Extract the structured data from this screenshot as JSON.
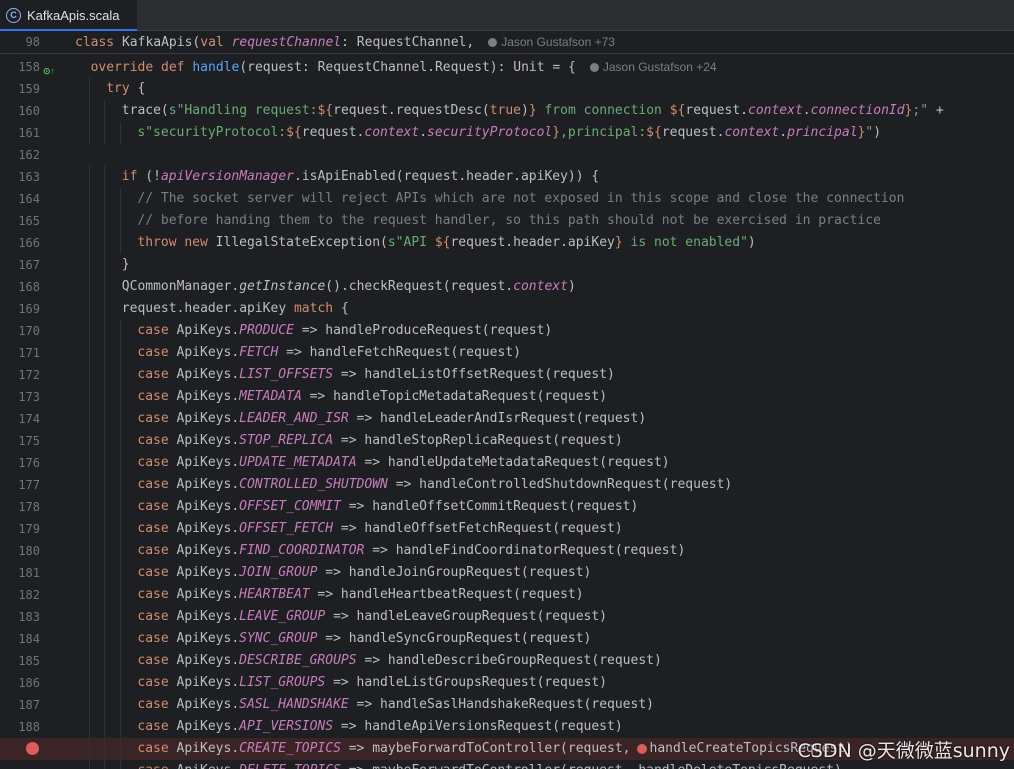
{
  "tab": {
    "label": "KafkaApis.scala",
    "icon": "scala-file-icon",
    "icon_glyph": "C"
  },
  "sticky": {
    "line": "98",
    "kw": "class",
    "name": "KafkaApis",
    "p_kw": "val",
    "param": "requestChannel",
    "rest": ": RequestChannel,",
    "author": "Jason Gustafson +73"
  },
  "lines": [
    {
      "n": "158",
      "html": "<span class=\"kw\">override def</span> <span class=\"fn\">handle</span>(request: RequestChannel.Request): Unit = {",
      "author": "Jason Gustafson +24",
      "indent": 1
    },
    {
      "n": "159",
      "html": "<span class=\"kw\">try</span> {",
      "indent": 2
    },
    {
      "n": "160",
      "html": "trace(<span class=\"str\">s\"Handling request:</span><span class=\"interp\">${</span>request.requestDesc(<span class=\"bool\">true</span>)<span class=\"interp\">}</span><span class=\"str\"> from connection </span><span class=\"interp\">${</span>request.<span class=\"pr\">context</span>.<span class=\"pr\">connectionId</span><span class=\"interp\">}</span><span class=\"str\">;\"</span> +",
      "indent": 3
    },
    {
      "n": "161",
      "html": "<span class=\"str\">s\"securityProtocol:</span><span class=\"interp\">${</span>request.<span class=\"pr\">context</span>.<span class=\"pr\">securityProtocol</span><span class=\"interp\">}</span><span class=\"str\">,principal:</span><span class=\"interp\">${</span>request.<span class=\"pr\">context</span>.<span class=\"pr\">principal</span><span class=\"interp\">}</span><span class=\"str\">\"</span>)",
      "indent": 4
    },
    {
      "n": "162",
      "html": "",
      "indent": 0
    },
    {
      "n": "163",
      "html": "<span class=\"kw\">if</span> (!<span class=\"pr\">apiVersionManager</span>.isApiEnabled(request.header.apiKey)) {",
      "indent": 3
    },
    {
      "n": "164",
      "html": "<span class=\"cm\">// The socket server will reject APIs which are not exposed in this scope and close the connection</span>",
      "indent": 4
    },
    {
      "n": "165",
      "html": "<span class=\"cm\">// before handing them to the request handler, so this path should not be exercised in practice</span>",
      "indent": 4
    },
    {
      "n": "166",
      "html": "<span class=\"kw\">throw new</span> IllegalStateException(<span class=\"str\">s\"API </span><span class=\"interp\">${</span>request.header.apiKey<span class=\"interp\">}</span><span class=\"str\"> is not enabled\"</span>)",
      "indent": 4
    },
    {
      "n": "167",
      "html": "}",
      "indent": 3
    },
    {
      "n": "168",
      "html": "QCommonManager.<span class=\"it\">getInstance</span>().checkRequest(request.<span class=\"pr\">context</span>)",
      "indent": 3
    },
    {
      "n": "169",
      "html": "request.header.apiKey <span class=\"kw\">match</span> {",
      "indent": 3
    },
    {
      "n": "170",
      "html": "<span class=\"kw\">case</span> ApiKeys.<span class=\"pr\">PRODUCE</span> =&gt; handleProduceRequest(request)",
      "indent": 4
    },
    {
      "n": "171",
      "html": "<span class=\"kw\">case</span> ApiKeys.<span class=\"pr\">FETCH</span> =&gt; handleFetchRequest(request)",
      "indent": 4
    },
    {
      "n": "172",
      "html": "<span class=\"kw\">case</span> ApiKeys.<span class=\"pr\">LIST_OFFSETS</span> =&gt; handleListOffsetRequest(request)",
      "indent": 4
    },
    {
      "n": "173",
      "html": "<span class=\"kw\">case</span> ApiKeys.<span class=\"pr\">METADATA</span> =&gt; handleTopicMetadataRequest(request)",
      "indent": 4
    },
    {
      "n": "174",
      "html": "<span class=\"kw\">case</span> ApiKeys.<span class=\"pr\">LEADER_AND_ISR</span> =&gt; handleLeaderAndIsrRequest(request)",
      "indent": 4
    },
    {
      "n": "175",
      "html": "<span class=\"kw\">case</span> ApiKeys.<span class=\"pr\">STOP_REPLICA</span> =&gt; handleStopReplicaRequest(request)",
      "indent": 4
    },
    {
      "n": "176",
      "html": "<span class=\"kw\">case</span> ApiKeys.<span class=\"pr\">UPDATE_METADATA</span> =&gt; handleUpdateMetadataRequest(request)",
      "indent": 4
    },
    {
      "n": "177",
      "html": "<span class=\"kw\">case</span> ApiKeys.<span class=\"pr\">CONTROLLED_SHUTDOWN</span> =&gt; handleControlledShutdownRequest(request)",
      "indent": 4
    },
    {
      "n": "178",
      "html": "<span class=\"kw\">case</span> ApiKeys.<span class=\"pr\">OFFSET_COMMIT</span> =&gt; handleOffsetCommitRequest(request)",
      "indent": 4
    },
    {
      "n": "179",
      "html": "<span class=\"kw\">case</span> ApiKeys.<span class=\"pr\">OFFSET_FETCH</span> =&gt; handleOffsetFetchRequest(request)",
      "indent": 4
    },
    {
      "n": "180",
      "html": "<span class=\"kw\">case</span> ApiKeys.<span class=\"pr\">FIND_COORDINATOR</span> =&gt; handleFindCoordinatorRequest(request)",
      "indent": 4
    },
    {
      "n": "181",
      "html": "<span class=\"kw\">case</span> ApiKeys.<span class=\"pr\">JOIN_GROUP</span> =&gt; handleJoinGroupRequest(request)",
      "indent": 4
    },
    {
      "n": "182",
      "html": "<span class=\"kw\">case</span> ApiKeys.<span class=\"pr\">HEARTBEAT</span> =&gt; handleHeartbeatRequest(request)",
      "indent": 4
    },
    {
      "n": "183",
      "html": "<span class=\"kw\">case</span> ApiKeys.<span class=\"pr\">LEAVE_GROUP</span> =&gt; handleLeaveGroupRequest(request)",
      "indent": 4
    },
    {
      "n": "184",
      "html": "<span class=\"kw\">case</span> ApiKeys.<span class=\"pr\">SYNC_GROUP</span> =&gt; handleSyncGroupRequest(request)",
      "indent": 4
    },
    {
      "n": "185",
      "html": "<span class=\"kw\">case</span> ApiKeys.<span class=\"pr\">DESCRIBE_GROUPS</span> =&gt; handleDescribeGroupRequest(request)",
      "indent": 4
    },
    {
      "n": "186",
      "html": "<span class=\"kw\">case</span> ApiKeys.<span class=\"pr\">LIST_GROUPS</span> =&gt; handleListGroupsRequest(request)",
      "indent": 4
    },
    {
      "n": "187",
      "html": "<span class=\"kw\">case</span> ApiKeys.<span class=\"pr\">SASL_HANDSHAKE</span> =&gt; handleSaslHandshakeRequest(request)",
      "indent": 4
    },
    {
      "n": "188",
      "html": "<span class=\"kw\">case</span> ApiKeys.<span class=\"pr\">API_VERSIONS</span> =&gt; handleApiVersionsRequest(request)",
      "indent": 4
    },
    {
      "n": "",
      "html": "<span class=\"kw\">case</span> ApiKeys.<span class=\"pr\">CREATE_TOPICS</span> =&gt; maybeForwardToController(request,<span class=\"inline-bp\"></span>handleCreateTopicsRequest)",
      "indent": 4,
      "breakpoint": true
    },
    {
      "n": "",
      "html": "<span class=\"kw\">case</span> ApiKeys.<span class=\"pr\">DELETE_TOPICS</span> =&gt; maybeForwardToController(request, handleDeleteTopicsRequest)",
      "indent": 4
    }
  ],
  "watermark": "CSDN @天微微蓝sunny"
}
